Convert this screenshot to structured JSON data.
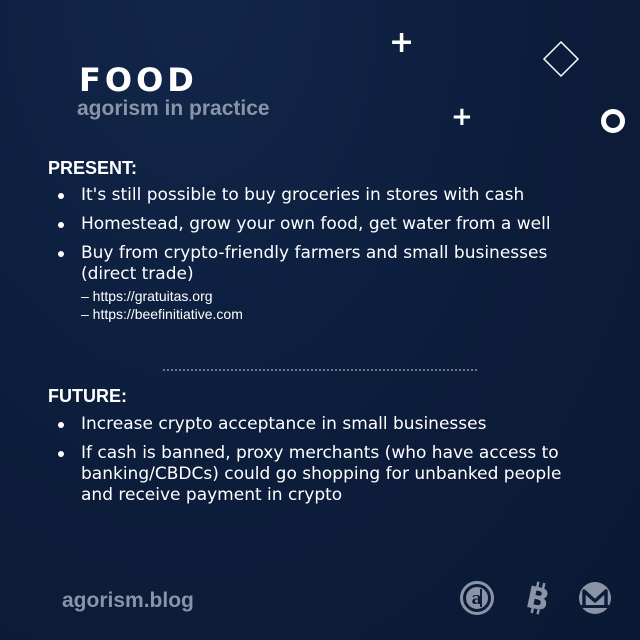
{
  "header": {
    "title": "FOOD",
    "subtitle": "agorism in practice"
  },
  "present": {
    "heading": "PRESENT:",
    "items": [
      "It's still possible to buy groceries in stores with cash",
      "Homestead, grow your own food, get water from a well",
      "Buy from crypto-friendly farmers and small businesses (direct trade)"
    ],
    "links": [
      "– https://gratuitas.org",
      "– https://beefinitiative.com"
    ]
  },
  "future": {
    "heading": "FUTURE:",
    "items": [
      "Increase crypto acceptance in small businesses",
      "If cash is banned, proxy merchants (who have access to banking/CBDCs) could go shopping for unbanked people and receive payment in crypto"
    ]
  },
  "footer": {
    "brand": "agorism.blog",
    "logos": [
      "agorism-icon",
      "bitcoin-icon",
      "monero-icon"
    ]
  },
  "colors": {
    "background": "#0c1d3b",
    "muted_text": "#8a94a6",
    "text": "#ffffff"
  }
}
